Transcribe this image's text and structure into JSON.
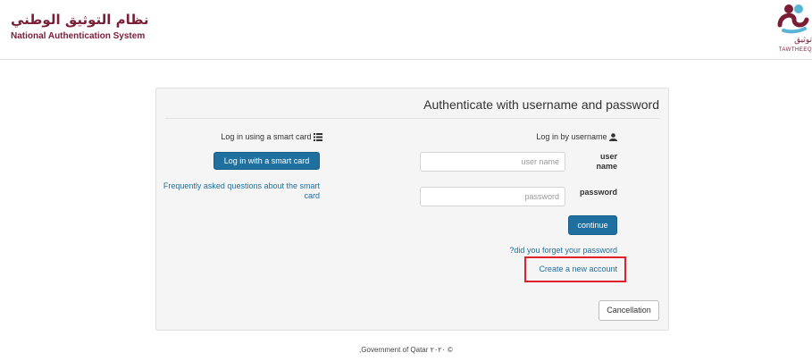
{
  "header": {
    "brand_ar": "نظام التوثيق الوطني",
    "brand_en": "National Authentication System",
    "logo_ar": "توثيق",
    "logo_en": "TAWTHEEQ"
  },
  "panel": {
    "title": "Authenticate with username and password",
    "smartcard": {
      "title": "Log in using a smart card",
      "button": "Log in with a smart card",
      "faq": "Frequently asked questions about the smart card"
    },
    "username": {
      "title": "Log in by username",
      "user_label": "user name",
      "user_placeholder": "user name",
      "pass_label": "password",
      "pass_placeholder": "password",
      "continue": "continue",
      "forgot": "?did you forget your password",
      "create": "Create a new account"
    },
    "cancel": "Cancellation"
  },
  "footer": {
    "text": ",Government of Qatar ٢٠٢٠ ©"
  },
  "colors": {
    "brand": "#7a1e35",
    "primary": "#1f6f9f",
    "highlight": "#e0202d"
  },
  "icons": {
    "smartcard": "list-icon",
    "username": "user-icon"
  }
}
